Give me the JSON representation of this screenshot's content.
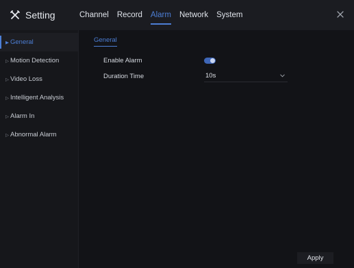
{
  "header": {
    "title": "Setting",
    "title_icon": "settings-tools-icon",
    "tabs": [
      {
        "label": "Channel"
      },
      {
        "label": "Record"
      },
      {
        "label": "Alarm"
      },
      {
        "label": "Network"
      },
      {
        "label": "System"
      }
    ],
    "active_tab": "Alarm",
    "close_icon": "close-icon"
  },
  "sidebar": {
    "items": [
      {
        "label": "General"
      },
      {
        "label": "Motion Detection"
      },
      {
        "label": "Video Loss"
      },
      {
        "label": "Intelligent Analysis"
      },
      {
        "label": "Alarm In"
      },
      {
        "label": "Abnormal Alarm"
      }
    ],
    "active_item": "General"
  },
  "content": {
    "subtab": "General",
    "enable_alarm": {
      "label": "Enable Alarm",
      "enabled": true
    },
    "duration_time": {
      "label": "Duration Time",
      "value": "10s"
    }
  },
  "footer": {
    "apply_label": "Apply"
  },
  "colors": {
    "accent": "#4d7fd6",
    "background": "#121317",
    "topbar": "#1b1c21",
    "sidebar": "#16171b"
  }
}
